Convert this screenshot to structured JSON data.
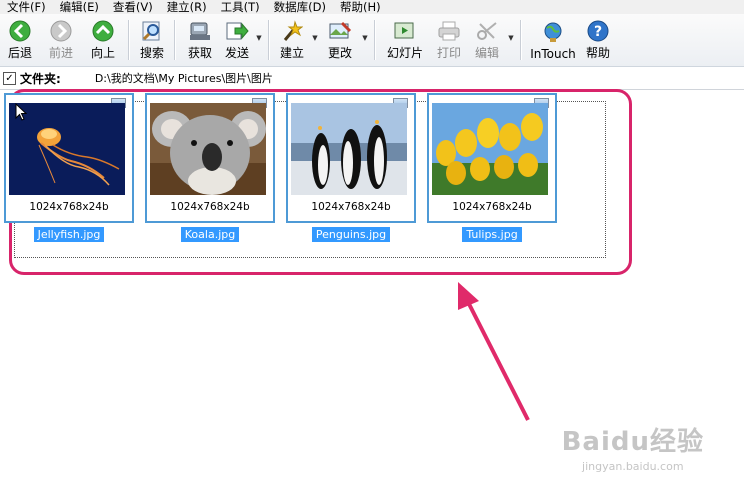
{
  "menu": [
    "文件(F)",
    "编辑(E)",
    "查看(V)",
    "建立(R)",
    "工具(T)",
    "数据库(D)",
    "帮助(H)"
  ],
  "toolbar": {
    "back": "后退",
    "forward": "前进",
    "up": "向上",
    "search": "搜索",
    "acquire": "获取",
    "send": "发送",
    "create": "建立",
    "modify": "更改",
    "slideshow": "幻灯片",
    "print": "打印",
    "edit": "编辑",
    "intouch": "InTouch",
    "help": "帮助"
  },
  "folder": {
    "label": "文件夹:",
    "checked": true,
    "path": "D:\\我的文档\\My Pictures\\图片\\图片"
  },
  "thumbnails": [
    {
      "name": "Jellyfish.jpg",
      "dims": "1024x768x24b",
      "selected": true
    },
    {
      "name": "Koala.jpg",
      "dims": "1024x768x24b",
      "selected": true
    },
    {
      "name": "Penguins.jpg",
      "dims": "1024x768x24b",
      "selected": true
    },
    {
      "name": "Tulips.jpg",
      "dims": "1024x768x24b",
      "selected": true
    }
  ],
  "watermark": {
    "main": "Baidu经验",
    "sub": "jingyan.baidu.com"
  },
  "colors": {
    "highlight": "#d8246a",
    "selection": "#3399ff",
    "frame": "#4e9ad6"
  }
}
